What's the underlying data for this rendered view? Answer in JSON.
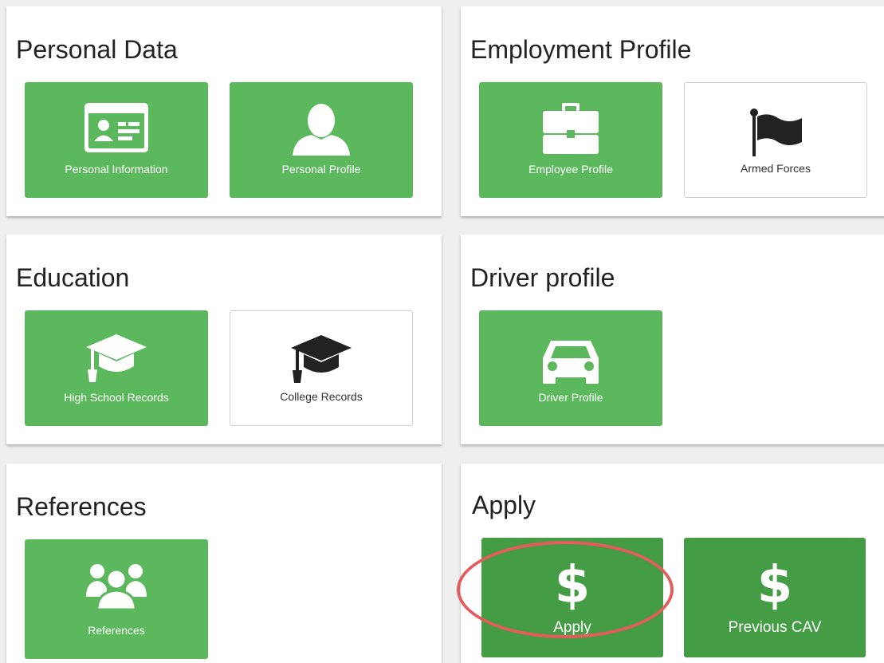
{
  "sections": {
    "personal_data": {
      "title": "Personal Data",
      "tiles": [
        {
          "label": "Personal Information",
          "icon": "id-card-icon"
        },
        {
          "label": "Personal Profile",
          "icon": "user-icon"
        }
      ]
    },
    "employment_profile": {
      "title": "Employment Profile",
      "tiles": [
        {
          "label": "Employee Profile",
          "icon": "briefcase-icon"
        },
        {
          "label": "Armed Forces",
          "icon": "flag-icon"
        }
      ]
    },
    "education": {
      "title": "Education",
      "tiles": [
        {
          "label": "High School Records",
          "icon": "graduation-cap-icon"
        },
        {
          "label": "College Records",
          "icon": "graduation-cap-icon"
        }
      ]
    },
    "driver_profile": {
      "title": "Driver profile",
      "tiles": [
        {
          "label": "Driver Profile",
          "icon": "car-icon"
        }
      ]
    },
    "references": {
      "title": "References",
      "tiles": [
        {
          "label": "References",
          "icon": "users-icon"
        }
      ]
    },
    "apply": {
      "title": "Apply",
      "tiles": [
        {
          "label": "Apply",
          "icon": "dollar-icon",
          "symbol": "$"
        },
        {
          "label": "Previous CAV",
          "icon": "dollar-icon",
          "symbol": "$"
        }
      ]
    }
  },
  "colors": {
    "tile_green": "#5cb85c",
    "tile_green_dark": "#449d44",
    "tile_white": "#ffffff",
    "highlight_ring": "#e35d5d",
    "background": "#efefef"
  }
}
